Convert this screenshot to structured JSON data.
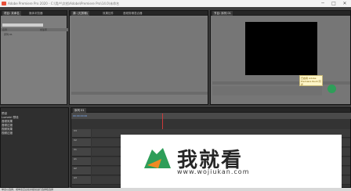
{
  "window": {
    "title": "Adobe Premiere Pro 2020 - C:\\用户\\文档\\Adobe\\Premiere Pro\\14.0\\未命名",
    "controls": {
      "minimize": "─",
      "maximize": "□",
      "close": "✕"
    }
  },
  "project_panel": {
    "tabs": [
      "项目: 未命名",
      "媒体浏览器"
    ],
    "column_name": "名称",
    "column_rate": "帧速率",
    "items": [
      "序列 01"
    ]
  },
  "source_panel": {
    "tabs": [
      "源: (无剪辑)",
      "效果控件",
      "音频剪辑混合器"
    ]
  },
  "program_panel": {
    "tabs": [
      "节目: 序列 01"
    ]
  },
  "effects_panel": {
    "items": [
      "预设",
      "Lumetri 预设",
      "音频效果",
      "音频过渡",
      "视频效果",
      "视频过渡"
    ]
  },
  "timeline_panel": {
    "tabs": [
      "序列 01"
    ],
    "timecode": "00:00:00:00",
    "tracks": [
      "V3",
      "V2",
      "V1",
      "A1",
      "A2",
      "A3"
    ]
  },
  "tooltip": {
    "text": "已启用 Adobe Premiere Rush 同步"
  },
  "watermark": {
    "title": "我就看",
    "url": "www.wojiukan.com"
  },
  "status": {
    "text": "单击以选择，或单击空白处并拖动进行选择框选择"
  },
  "colors": {
    "watermark_green": "#2e9e59",
    "watermark_orange": "#f08a24",
    "export_button": "#2e9e59"
  }
}
